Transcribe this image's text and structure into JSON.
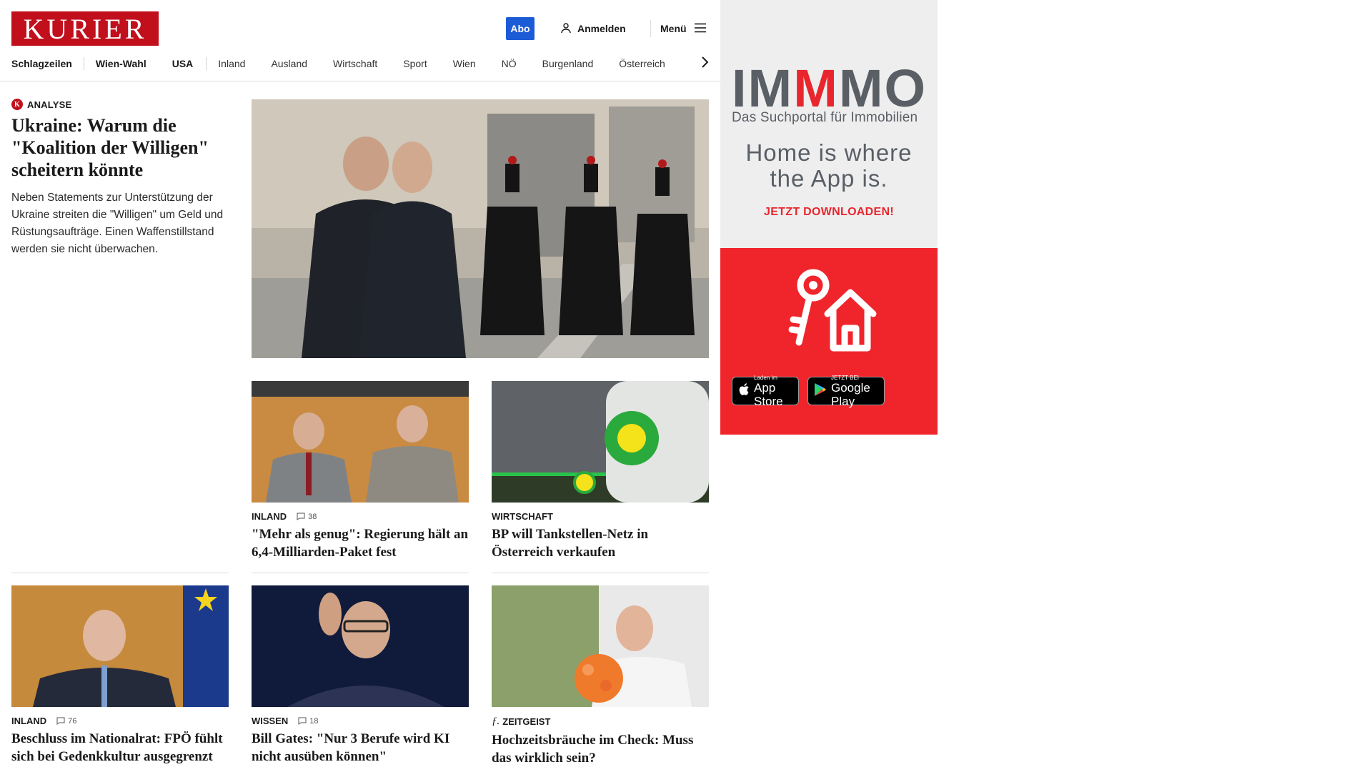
{
  "header": {
    "logo": "KURIER",
    "abo_label": "Abo",
    "login_label": "Anmelden",
    "menu_label": "Menü"
  },
  "nav": {
    "items": [
      "Schlagzeilen",
      "Wien-Wahl",
      "USA",
      "Inland",
      "Ausland",
      "Wirtschaft",
      "Sport",
      "Wien",
      "NÖ",
      "Burgenland",
      "Österreich"
    ]
  },
  "lead": {
    "kicker": "ANALYSE",
    "title": "Ukraine: Warum die \"Koalition der Willigen\" scheitern könnte",
    "teaser": "Neben Statements zur Unterstützung der Ukraine streiten die \"Willigen\" um Geld und Rüstungsaufträge. Einen Waffenstillstand werden sie nicht überwachen."
  },
  "articles": [
    {
      "category": "INLAND",
      "comments": "38",
      "title": "\"Mehr als genug\": Regierung hält an 6,4-Milliarden-Paket fest"
    },
    {
      "category": "WIRTSCHAFT",
      "comments": "",
      "title": "BP will Tankstellen-Netz in Österreich verkaufen"
    },
    {
      "category": "INLAND",
      "comments": "76",
      "title": "Beschluss im Nationalrat: FPÖ fühlt sich bei Gedenkkultur ausgegrenzt"
    },
    {
      "category": "WISSEN",
      "comments": "18",
      "title": "Bill Gates: \"Nur 3 Berufe wird KI nicht ausüben können\""
    },
    {
      "category": "ZEITGEIST",
      "comments": "",
      "title": "Hochzeitsbräuche im Check: Muss das wirklich sein?"
    }
  ],
  "ad": {
    "brand_grey_1": "IM",
    "brand_red": "M",
    "brand_grey_2": "MO",
    "subtitle": "Das Suchportal für Immobilien",
    "slogan_line1": "Home is where",
    "slogan_line2": "the App is.",
    "cta": "JETZT DOWNLOADEN!",
    "appstore_small": "Laden im",
    "appstore_big": "App Store",
    "googleplay_small": "JETZT BEI",
    "googleplay_big": "Google Play"
  },
  "colors": {
    "brand_red": "#c10f1c",
    "abo_blue": "#1c5bd6",
    "ad_red": "#f0252c",
    "ad_grey": "#5a5f66"
  }
}
